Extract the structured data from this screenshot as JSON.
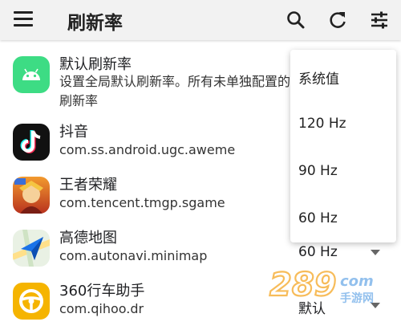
{
  "appbar": {
    "title": "刷新率"
  },
  "apps": [
    {
      "name": "默认刷新率",
      "desc": "设置全局默认刷新率。所有未单独配置的应用默认使用此刷新率"
    },
    {
      "name": "抖音",
      "package": "com.ss.android.ugc.aweme",
      "rate": ""
    },
    {
      "name": "王者荣耀",
      "package": "com.tencent.tmgp.sgame",
      "rate": ""
    },
    {
      "name": "高德地图",
      "package": "com.autonavi.minimap",
      "rate": "60 Hz"
    },
    {
      "name": "360行车助手",
      "package": "com.qihoo.dr",
      "rate": "默认"
    }
  ],
  "dropdown": {
    "options": [
      "系统值",
      "120 Hz",
      "90 Hz",
      "60 Hz"
    ]
  },
  "watermark": {
    "text": "289.com",
    "sub": "手游网"
  },
  "colors": {
    "appbar_bg": "#f2f2f2",
    "android_green": "#3ddc84",
    "tiktok_bg": "#111111",
    "amap_blue": "#1a73e8",
    "accent_orange": "#f5b400"
  }
}
